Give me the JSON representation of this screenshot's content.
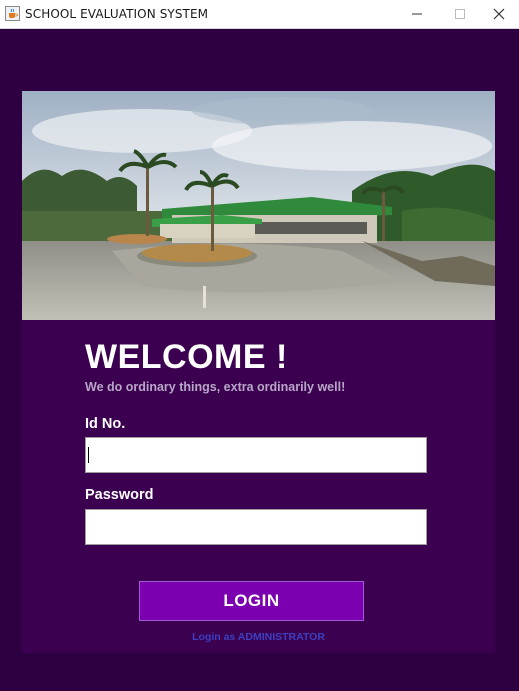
{
  "window": {
    "title": "SCHOOL EVALUATION SYSTEM",
    "icon": "java-cup-icon",
    "controls": [
      "minimize-icon",
      "maximize-icon",
      "close-icon"
    ]
  },
  "colors": {
    "background": "#2e0042",
    "panel": "#3b0050",
    "login_button": "#7a00b0",
    "admin_link": "#3c3fc0",
    "motto": "#b9a6c9"
  },
  "banner": {
    "image": "campus-building-photo"
  },
  "login": {
    "heading": "WELCOME !",
    "motto": "We do ordinary things, extra ordinarily well!",
    "id_label": "Id No.",
    "id_value": "",
    "password_label": "Password",
    "password_value": "",
    "login_button": "LOGIN",
    "admin_link": "Login as ADMINISTRATOR"
  }
}
